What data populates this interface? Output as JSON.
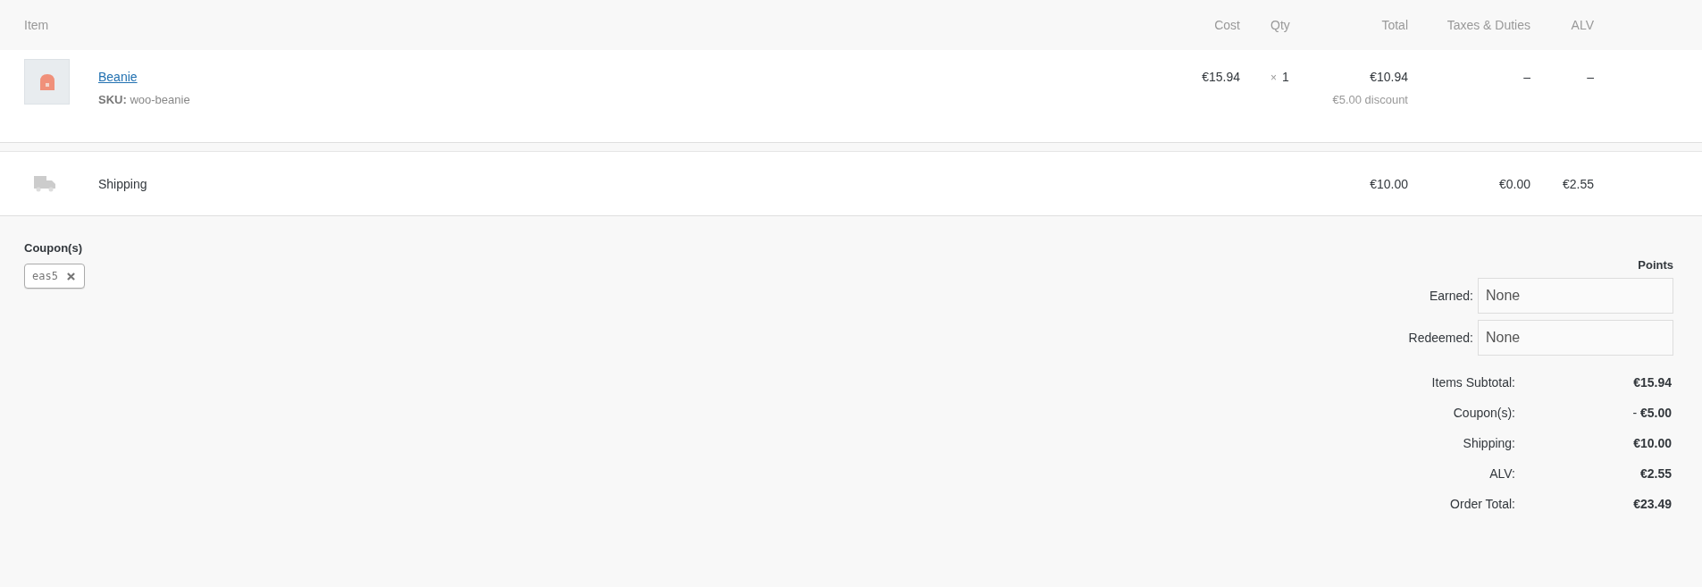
{
  "columns": [
    "Item",
    "Cost",
    "Qty",
    "Total",
    "Taxes & Duties",
    "ALV"
  ],
  "items": [
    {
      "name": "Beanie",
      "sku_label": "SKU:",
      "sku": "woo-beanie",
      "cost": "€15.94",
      "qty_sign": "×",
      "qty": "1",
      "total": "€10.94",
      "discount": "€5.00 discount",
      "taxes": "–",
      "alv": "–"
    }
  ],
  "shipping": {
    "label": "Shipping",
    "total": "€10.00",
    "taxes": "€0.00",
    "alv": "€2.55"
  },
  "coupons": {
    "heading": "Coupon(s)",
    "items": [
      {
        "code": "eas5"
      }
    ]
  },
  "points": {
    "heading": "Points",
    "fields": [
      {
        "label": "Earned:",
        "value": "None"
      },
      {
        "label": "Redeemed:",
        "value": "None"
      }
    ]
  },
  "totals": [
    {
      "label": "Items Subtotal:",
      "value": "€15.94"
    },
    {
      "label": "Coupon(s):",
      "prefix": "-",
      "value": "€5.00"
    },
    {
      "label": "Shipping:",
      "value": "€10.00"
    },
    {
      "label": "ALV:",
      "value": "€2.55"
    },
    {
      "label": "Order Total:",
      "value": "€23.49"
    }
  ]
}
